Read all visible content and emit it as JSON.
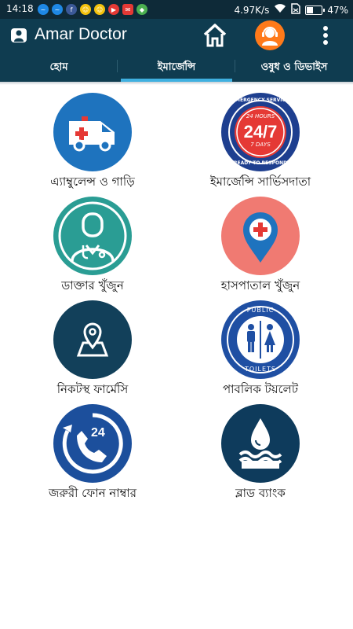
{
  "status_bar": {
    "time": "14:18",
    "speed": "4.97K/s",
    "battery": "47%",
    "battery_level": 0.47,
    "notification_icons": [
      "messenger-icon",
      "messenger-icon",
      "facebook-icon",
      "smiley-icon",
      "smiley-icon",
      "youtube-icon",
      "message-icon",
      "maps-icon"
    ]
  },
  "app_bar": {
    "title": "Amar Doctor",
    "color": "#0f3c50",
    "accent": "#ff7a1a"
  },
  "tabs": [
    {
      "label": "হোম",
      "active": false
    },
    {
      "label": "ইমার্জেন্সি",
      "active": true
    },
    {
      "label": "ওষুধ ও ডিভাইস",
      "active": false
    }
  ],
  "tab_indicator_color": "#3fb0e0",
  "services": [
    {
      "label": "এ্যাম্বুলেন্স ও গাড়ি",
      "icon": "ambulance-icon",
      "color": "#1e73be"
    },
    {
      "label": "ইমার্জেন্সি সার্ভিসদাতা",
      "icon": "emergency-service-24-7-icon",
      "color": "#1e3f8f",
      "badge": {
        "top": "EMERGENCY SERVICE",
        "hours": "24 HOURS",
        "big": "24/7",
        "days": "7 DAYS",
        "bottom": "READY TO RESPOND"
      }
    },
    {
      "label": "ডাক্তার খুঁজুন",
      "icon": "doctor-icon",
      "color": "#2a9d94"
    },
    {
      "label": "হাসপাতাল খুঁজুন",
      "icon": "hospital-location-icon",
      "color": "#f07a72"
    },
    {
      "label": "নিকটস্থ ফার্মেসি",
      "icon": "pharmacy-location-icon",
      "color": "#12405a"
    },
    {
      "label": "পাবলিক টয়লেট",
      "icon": "public-toilet-icon",
      "color": "#1f4fa3",
      "badge": {
        "top": "PUBLIC",
        "bottom": "TOILETS"
      }
    },
    {
      "label": "জরুরী ফোন নাম্বার",
      "icon": "emergency-phone-24-icon",
      "color": "#1c4f9c",
      "badge": {
        "big": "24"
      }
    },
    {
      "label": "ব্লাড ব্যাংক",
      "icon": "blood-bank-icon",
      "color": "#0e3b5c"
    }
  ]
}
